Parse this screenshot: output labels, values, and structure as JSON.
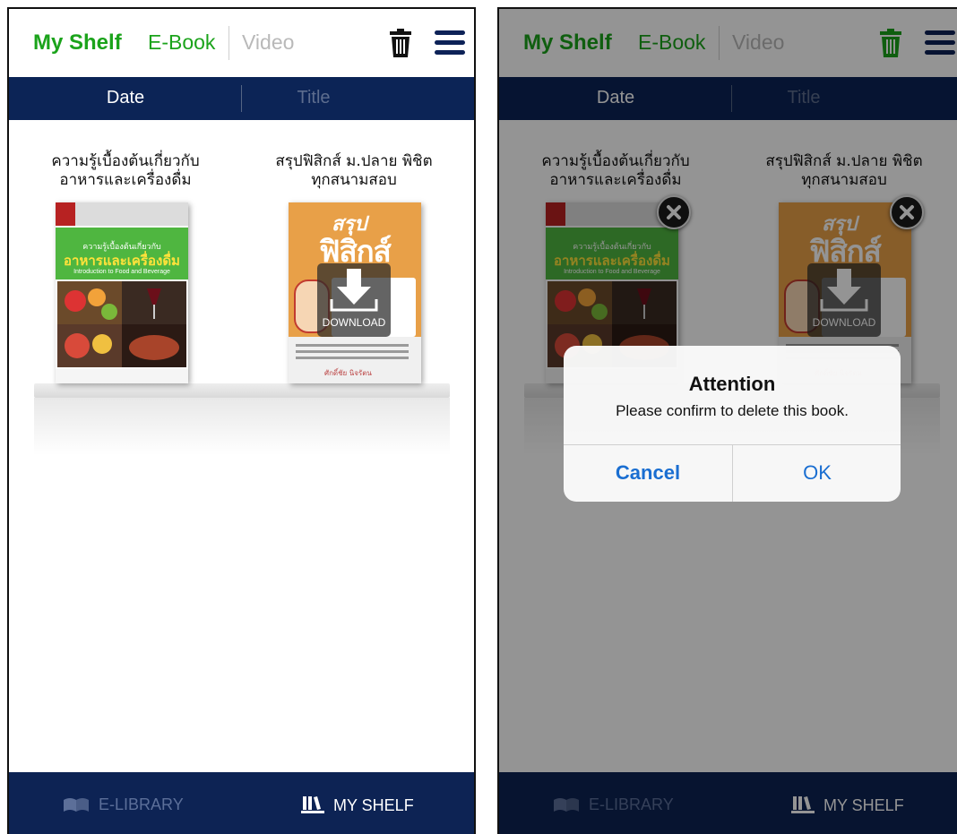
{
  "header": {
    "my_shelf": "My Shelf",
    "tab_ebook": "E-Book",
    "tab_video": "Video",
    "trash_icon": "trash-icon",
    "menu_icon": "hamburger-menu-icon"
  },
  "sort": {
    "date": "Date",
    "title": "Title"
  },
  "books": [
    {
      "title_line1": "ความรู้เบื้องต้นเกี่ยวกับ",
      "title_line2": "อาหารและเครื่องดื่ม",
      "cover": {
        "subtitle": "ความรู้เบื้องต้นเกี่ยวกับ",
        "main": "อาหารและเครื่องดื่ม",
        "english": "Introduction to Food and Beverage"
      }
    },
    {
      "title_line1": "สรุปฟิสิกส์ ม.ปลาย พิชิต",
      "title_line2": "ทุกสนามสอบ",
      "cover": {
        "top": "สรุป",
        "main": "ฟิสิกส์",
        "author": "ศักดิ์ชัย นิจรัตน"
      }
    }
  ],
  "download_label": "DOWNLOAD",
  "bottom_nav": {
    "library": "E-LIBRARY",
    "shelf": "MY SHELF"
  },
  "dialog": {
    "title": "Attention",
    "message": "Please confirm to delete this book.",
    "cancel": "Cancel",
    "ok": "OK"
  },
  "colors": {
    "brand_green": "#1ba31b",
    "navy": "#0c2456",
    "ios_blue": "#1a6ed1",
    "trash_active": "#1ba31b",
    "trash_normal": "#111111"
  }
}
